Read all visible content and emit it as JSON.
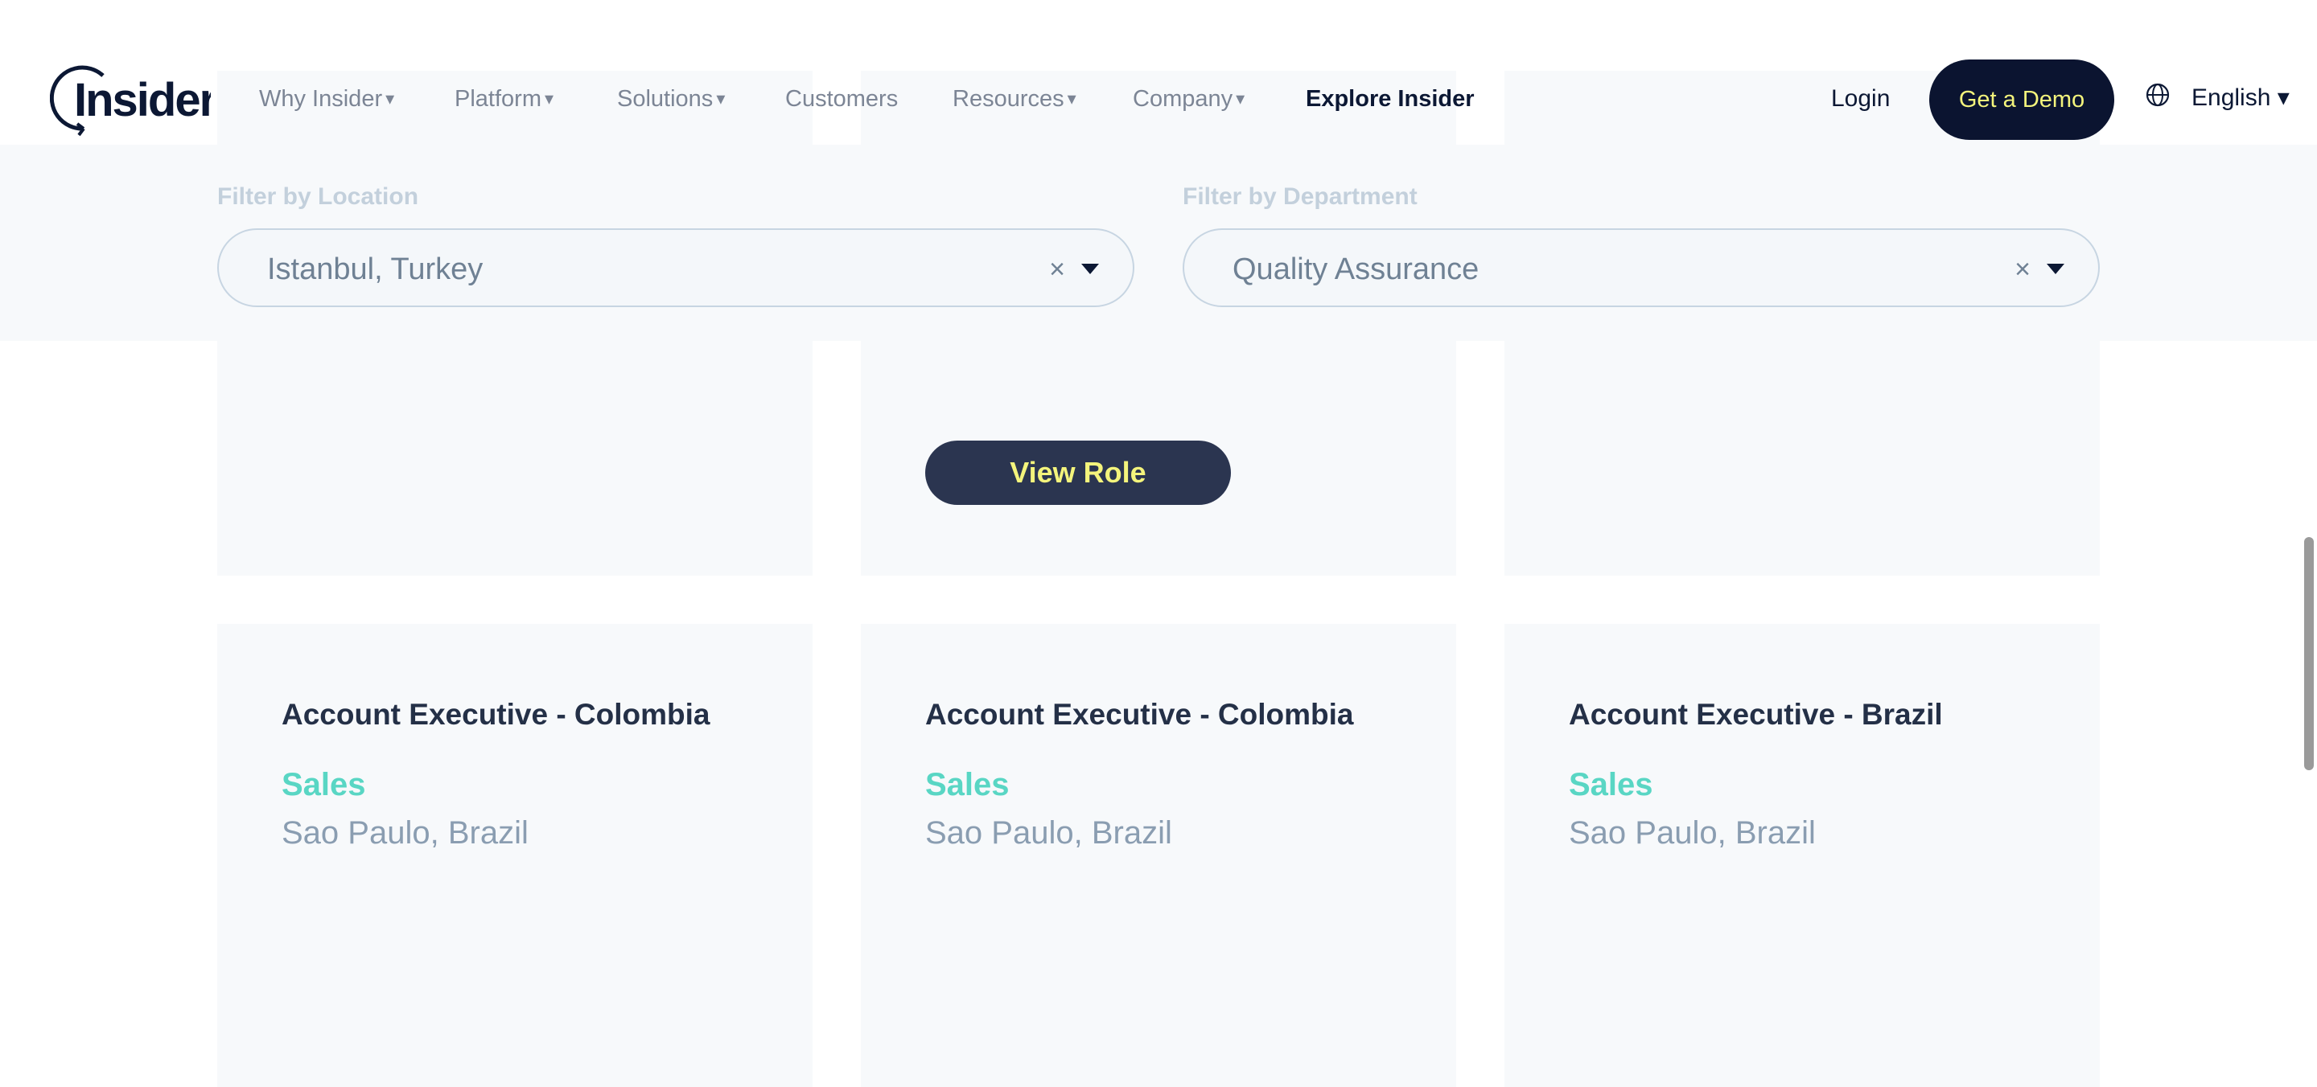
{
  "header": {
    "nav": [
      {
        "label": "Why Insider",
        "caret": "▾"
      },
      {
        "label": "Platform",
        "caret": "▾"
      },
      {
        "label": "Solutions",
        "caret": "▾"
      },
      {
        "label": "Customers",
        "caret": ""
      },
      {
        "label": "Resources",
        "caret": "▾"
      },
      {
        "label": "Company",
        "caret": "▾"
      },
      {
        "label": "Explore Insider",
        "caret": ""
      }
    ],
    "login_label": "Login",
    "demo_label": "Get a Demo",
    "language_label": "English ▾"
  },
  "filters": {
    "location_label": "Filter by Location",
    "location_value": "Istanbul, Turkey",
    "department_label": "Filter by Department",
    "department_value": "Quality Assurance",
    "clear_symbol": "×"
  },
  "top_row": {
    "view_role_label": "View Role"
  },
  "jobs": [
    {
      "title": "Account Executive - Colombia",
      "department": "Sales",
      "location": "Sao Paulo, Brazil"
    },
    {
      "title": "Account Executive - Colombia",
      "department": "Sales",
      "location": "Sao Paulo, Brazil"
    },
    {
      "title": "Account Executive - Brazil",
      "department": "Sales",
      "location": "Sao Paulo, Brazil"
    }
  ],
  "colors": {
    "accent_teal": "#59d6c4",
    "dark_navy": "#0b1430",
    "button_text_yellow": "#f4f47c"
  }
}
